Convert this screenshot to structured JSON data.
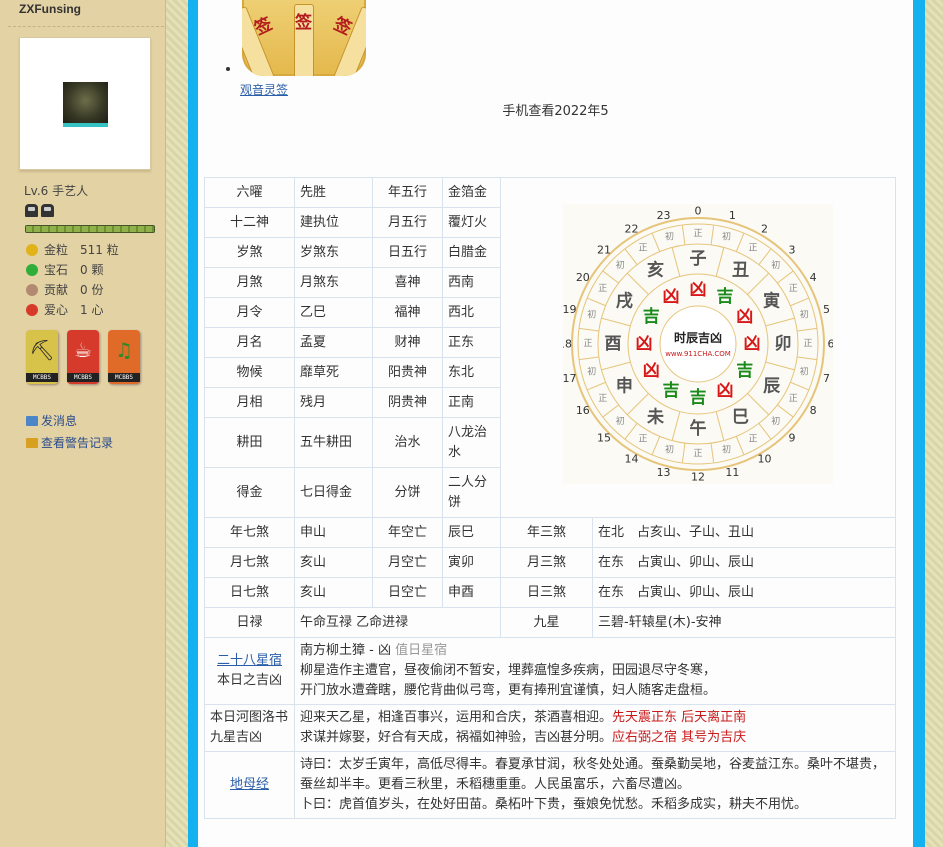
{
  "profile": {
    "username": "ZXFunsing",
    "level_text": "Lv.6 手艺人",
    "exp_progress": 1.0,
    "stats": [
      {
        "label": "金粒",
        "value": "511 粒",
        "icon": "gold-icon",
        "color": "#e2b21a"
      },
      {
        "label": "宝石",
        "value": "0 颗",
        "icon": "gem-icon",
        "color": "#2fae3a"
      },
      {
        "label": "贡献",
        "value": "0 份",
        "icon": "contribution-icon",
        "color": "#b28a72"
      },
      {
        "label": "爱心",
        "value": "1 心",
        "icon": "heart-icon",
        "color": "#d83a2a"
      }
    ],
    "medals": [
      {
        "label": "MCBBS",
        "icon": "pickaxe-icon",
        "color": "#d7c24a"
      },
      {
        "label": "MCBBS",
        "icon": "java-icon",
        "color": "#d63a2a"
      },
      {
        "label": "MCBBS",
        "icon": "music-icon",
        "color": "#e06a28"
      }
    ],
    "links": [
      {
        "label": "发消息",
        "icon": "mail-icon"
      },
      {
        "label": "查看警告记录",
        "icon": "warning-record-icon"
      }
    ]
  },
  "content": {
    "lot_link": "观音灵签",
    "lot_chars": [
      "签",
      "签",
      "签"
    ],
    "mobile_title": "手机查看2022年5"
  },
  "almanac": {
    "left_rows": [
      [
        "六曜",
        "先胜",
        "年五行",
        "金箔金"
      ],
      [
        "十二神",
        "建执位",
        "月五行",
        "覆灯火"
      ],
      [
        "岁煞",
        "岁煞东",
        "日五行",
        "白腊金"
      ],
      [
        "月煞",
        "月煞东",
        "喜神",
        "西南"
      ],
      [
        "月令",
        "乙巳",
        "福神",
        "西北"
      ],
      [
        "月名",
        "孟夏",
        "财神",
        "正东"
      ],
      [
        "物候",
        "靡草死",
        "阳贵神",
        "东北"
      ],
      [
        "月相",
        "残月",
        "阴贵神",
        "正南"
      ],
      [
        "耕田",
        "五牛耕田",
        "治水",
        "八龙治水"
      ],
      [
        "得金",
        "七日得金",
        "分饼",
        "二人分饼"
      ]
    ],
    "sha_rows": [
      [
        "年七煞",
        "申山",
        "年空亡",
        "辰巳",
        "年三煞",
        "在北　占亥山、子山、丑山"
      ],
      [
        "月七煞",
        "亥山",
        "月空亡",
        "寅卯",
        "月三煞",
        "在东　占寅山、卯山、辰山"
      ],
      [
        "日七煞",
        "亥山",
        "日空亡",
        "申酉",
        "日三煞",
        "在东　占寅山、卯山、辰山"
      ]
    ],
    "rilu": {
      "label": "日禄",
      "value": "午命互禄 乙命进禄",
      "jiuxing_label": "九星",
      "jiuxing_value": "三碧-轩辕星(木)-安神"
    },
    "stars28": {
      "label_link": "二十八星宿",
      "label_rest": "本日之吉凶",
      "title": "南方柳土獐 - 凶",
      "title_suffix": "值日星宿",
      "line1": "柳星造作主遭官，昼夜偷闭不暂安，埋葬瘟惶多疾病，田园退尽守冬寒，",
      "line2": "开门放水遭聋瞎，腰佗背曲似弓弯，更有捧刑宜谨慎，妇人随客走盘桓。"
    },
    "hetu": {
      "label": "本日河图洛书九星吉凶",
      "l1_black": "迎来天乙星，相逢百事兴，运用和合庆，茶酒喜相迎。",
      "l1_red": "先天震正东 后天离正南",
      "l2_black": "求谋并嫁娶，好合有天成，祸福如神验，吉凶甚分明。",
      "l2_red": "应右弼之宿 其号为吉庆"
    },
    "dimu": {
      "label": "地母经",
      "poem1": "诗曰：太岁壬寅年，高低尽得丰。春夏承甘润，秋冬处处通。蚕桑勤吴地，谷麦益江东。桑叶不堪贵，蚕丝却半丰。更看三秋里，禾稻穗重重。人民虽富乐，六畜尽遭凶。",
      "poem2": "卜曰：虎首值岁头，在处好田苗。桑柘叶下贵，蚕娘免忧愁。禾稻多成实，耕夫不用忧。"
    },
    "wheel": {
      "center_title": "时辰吉凶",
      "center_site": "www.911CHA.COM",
      "hours": [
        "0",
        "1",
        "2",
        "3",
        "4",
        "5",
        "6",
        "7",
        "8",
        "9",
        "10",
        "11",
        "12",
        "13",
        "14",
        "15",
        "16",
        "17",
        "18",
        "19",
        "20",
        "21",
        "22",
        "23"
      ],
      "branches": [
        "子",
        "丑",
        "寅",
        "卯",
        "辰",
        "巳",
        "午",
        "未",
        "申",
        "酉",
        "戌",
        "亥"
      ],
      "verdicts": [
        "凶",
        "吉",
        "凶",
        "凶",
        "吉",
        "凶",
        "吉",
        "吉",
        "凶",
        "凶",
        "吉",
        "凶"
      ],
      "ring_chars": [
        "正",
        "初",
        "正",
        "初",
        "正",
        "初",
        "正",
        "初",
        "正",
        "初",
        "正",
        "初",
        "正",
        "初",
        "正",
        "初",
        "正",
        "初",
        "正",
        "初",
        "正",
        "初",
        "正",
        "初"
      ],
      "colors": {
        "lucky": "#1a8a1a",
        "unlucky": "#d81818",
        "ring": "#e6c47a",
        "branch": "#555555"
      }
    }
  }
}
